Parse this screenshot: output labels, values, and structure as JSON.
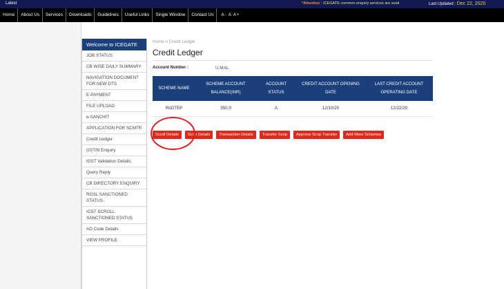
{
  "topbar": {
    "latest_label": "Latest",
    "attention_prefix": "*Attention :",
    "attention_text": "ICEGATE common enquiry services are avail",
    "last_updated_label": "Last Updated :",
    "last_updated_date": "Dec 22, 2020"
  },
  "nav": {
    "items": [
      "Home",
      "About Us",
      "Services",
      "Downloads",
      "Guidelines",
      "Useful Links",
      "Single Window",
      "Contact Us"
    ],
    "font_sizer": "A- A A+"
  },
  "sidebar": {
    "welcome": "Welcome to ICEGATE",
    "items": [
      "JOB STATUS",
      "CB WISE DAILY SUMMARY",
      "NAVIGATION DOCUMENT FOR NEW DTS",
      "E-PAYMENT",
      "FILE UPLOAD",
      "e-SANCHIT",
      "APPLICATION FOR SCMTR",
      "Credit Ledger",
      "GSTIN Enquiry",
      "IGST Validation Details",
      "Query Reply",
      "CB DIRECTORY ENQUIRY",
      "ROSL SANCTIONED STATUS",
      "IGST SCROLL SANCTIONED STATUS",
      "AD Code Details",
      "VIEW PROFILE"
    ]
  },
  "main": {
    "breadcrumb": "Home » Credit Ledger",
    "title": "Credit Ledger",
    "account_label": "Account Number :",
    "account_value": "U.MAL",
    "table": {
      "headers": [
        "SCHEME NAME",
        "SCHEME ACCOUNT BALANCE(INR)",
        "ACCOUNT STATUS",
        "CREDIT ACCOUNT OPENING DATE",
        "LAST CREDIT ACCOUNT OPERATING DATE"
      ],
      "rows": [
        [
          "RoDTEP",
          "350.0",
          "A",
          "12/10/20",
          "12/22/20"
        ]
      ]
    },
    "buttons": [
      "Scroll Details",
      "Scrip Details",
      "Transaction Details",
      "Transfer Scrip",
      "Approve Scrip Transfer",
      "Add More Schemes"
    ]
  },
  "colors": {
    "nav_bg": "#000000",
    "topbar_bg": "#121a52",
    "header_blue": "#1b3f7a",
    "button_red": "#e0281c",
    "highlight_red": "#e11f1f"
  }
}
